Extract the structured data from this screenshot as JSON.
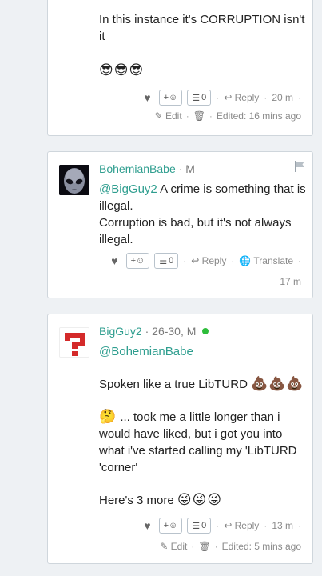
{
  "comments": [
    {
      "body_lines": [
        "In this instance it's CORRUPTION isn't",
        "it"
      ],
      "emoji_line": "😎😎😎",
      "actions": {
        "like_icon": "heart-icon",
        "react_label": "+☺",
        "list_count": "0",
        "reply_label": "Reply",
        "time": "20 m"
      },
      "sub_actions": {
        "edit_label": "Edit",
        "edited_label": "Edited: 16 mins ago"
      }
    },
    {
      "author": "BohemianBabe",
      "badge": "M",
      "mention": "@BigGuy2",
      "body_first": " A crime is something that is",
      "body_lines": [
        "illegal.",
        "Corruption is bad, but it's not always",
        "illegal."
      ],
      "actions": {
        "react_label": "+☺",
        "list_count": "0",
        "reply_label": "Reply",
        "translate_label": "Translate",
        "time": "17 m"
      }
    },
    {
      "author": "BigGuy2",
      "badge": "26-30, M",
      "mention": "@BohemianBabe",
      "line_libturd": "Spoken like a true LibTURD",
      "poop_emoji": "💩💩💩",
      "think_emoji": "🤔",
      "think_lines": [
        "... took me a little longer than i",
        "would have liked, but i got you into",
        "what i've started calling my 'LibTURD",
        "'corner'"
      ],
      "more_text": "Here's 3 more",
      "silly_emoji": "😜😜😜",
      "actions": {
        "react_label": "+☺",
        "list_count": "0",
        "reply_label": "Reply",
        "time": "13 m"
      },
      "sub_actions": {
        "edit_label": "Edit",
        "edited_label": "Edited: 5 mins ago"
      }
    }
  ],
  "colors": {
    "accent": "#2f9e8f",
    "online": "#2dbd3a",
    "background": "#eef1f4"
  }
}
